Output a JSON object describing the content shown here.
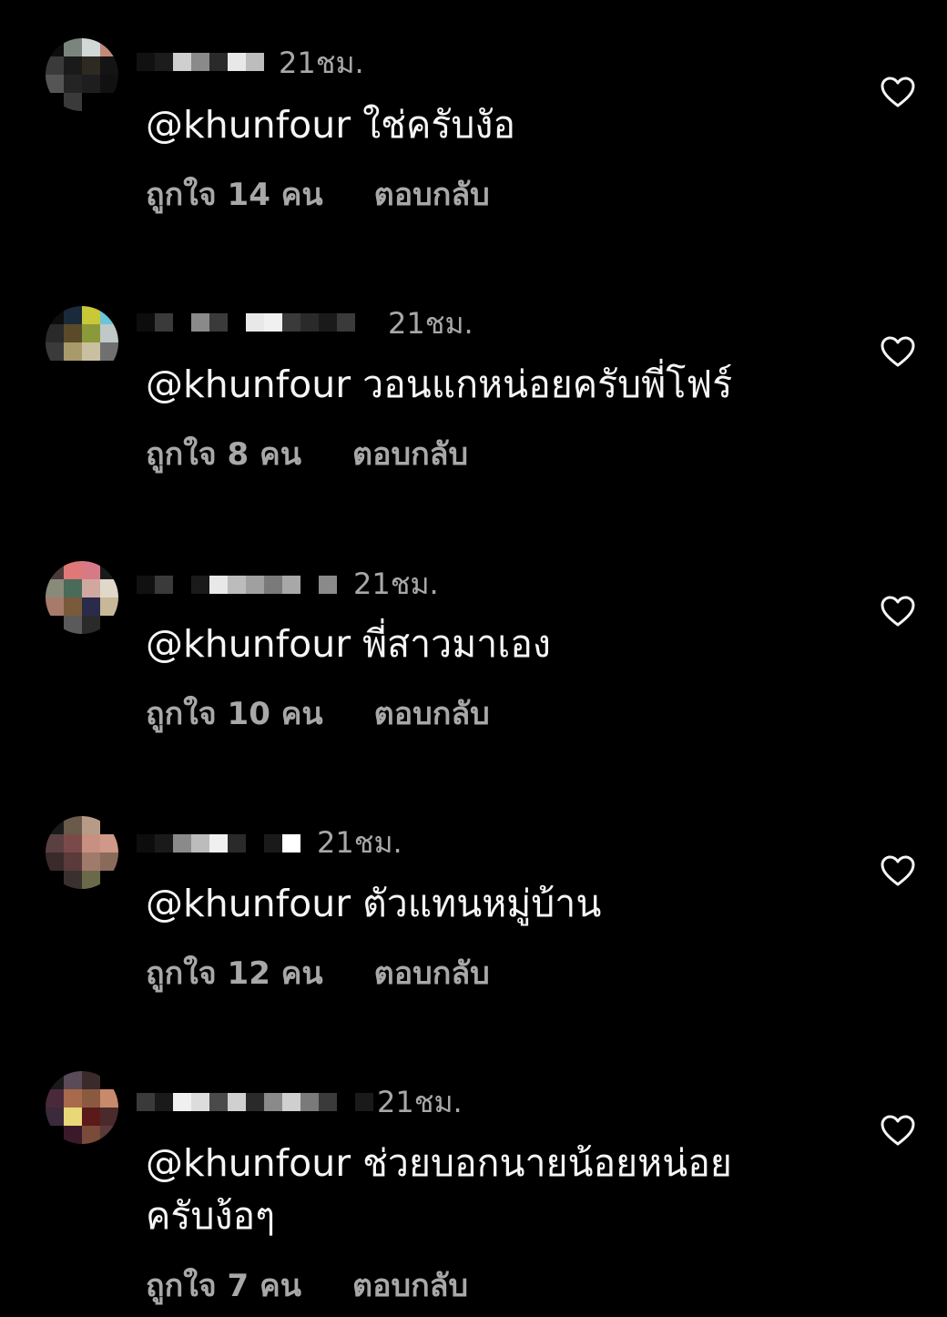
{
  "comments": [
    {
      "time": "21ชม.",
      "text": "@khunfour ใช่ครับงัอ",
      "likes": "ถูกใจ 14 คน",
      "reply": "ตอบกลับ",
      "heart_icon": "heart-outline-icon",
      "avatar_colors": [
        "#0d0d0d",
        "#7a857e",
        "#d2d7d7",
        "#c08a78",
        "#3a3a3a",
        "#1a1a1a",
        "#2e2a22",
        "#141414",
        "#555555",
        "#242424",
        "#1e1e1e",
        "#111111",
        "#000000",
        "#3a3a3a",
        "#000000",
        "#000000"
      ]
    },
    {
      "time": "21ชม.",
      "text": "@khunfour วอนแกหน่อยครับพี่โฟร์",
      "likes": "ถูกใจ 8 คน",
      "reply": "ตอบกลับ",
      "heart_icon": "heart-outline-icon",
      "avatar_colors": [
        "#0d0d0d",
        "#1a2a3a",
        "#c8c838",
        "#6cc4d8",
        "#2a2a2a",
        "#5a4a2a",
        "#8a9a3a",
        "#c0c8c8",
        "#3a3a3a",
        "#a89a6a",
        "#c8c0a0",
        "#707070",
        "#000000",
        "#000000",
        "#000000",
        "#000000"
      ]
    },
    {
      "time": "21ชม.",
      "text": "@khunfour พี่สาวมาเอง",
      "likes": "ถูกใจ 10 คน",
      "reply": "ตอบกลับ",
      "heart_icon": "heart-outline-icon",
      "avatar_colors": [
        "#4a3a3a",
        "#e07878",
        "#d87a86",
        "#1a1a1a",
        "#8a8a7a",
        "#4a6a5a",
        "#d0a8a0",
        "#e0d8c8",
        "#a87a6a",
        "#7a5a3a",
        "#2a2a4a",
        "#c8b898",
        "#000000",
        "#5a5a5a",
        "#2a2a2a",
        "#000000"
      ]
    },
    {
      "time": "21ชม.",
      "text": "@khunfour ตัวแทนหมู่บ้าน",
      "likes": "ถูกใจ 12 คน",
      "reply": "ตอบกลับ",
      "heart_icon": "heart-outline-icon",
      "avatar_colors": [
        "#1a1a1a",
        "#6a5a4a",
        "#b89a88",
        "#000000",
        "#5a4040",
        "#7a4a4a",
        "#c89080",
        "#d09888",
        "#3a2a2a",
        "#5a3a3a",
        "#a07a6a",
        "#8a6a5a",
        "#000000",
        "#3a3030",
        "#6a6a4a",
        "#000000"
      ]
    },
    {
      "time": "21ชม.",
      "text": "@khunfour ช่วยบอกนายน้อยหน่อยครับง้อๆ",
      "likes": "ถูกใจ 7 คน",
      "reply": "ตอบกลับ",
      "heart_icon": "heart-outline-icon",
      "avatar_colors": [
        "#1a1a1a",
        "#5a4a5a",
        "#3a2a2a",
        "#000000",
        "#4a2a3a",
        "#a86a4a",
        "#8a5a40",
        "#c88a6a",
        "#3a2a3a",
        "#e8d878",
        "#5a1a1a",
        "#4a2a2a",
        "#000000",
        "#3a1a2a",
        "#7a4a3a",
        "#5a3a3a"
      ]
    }
  ]
}
